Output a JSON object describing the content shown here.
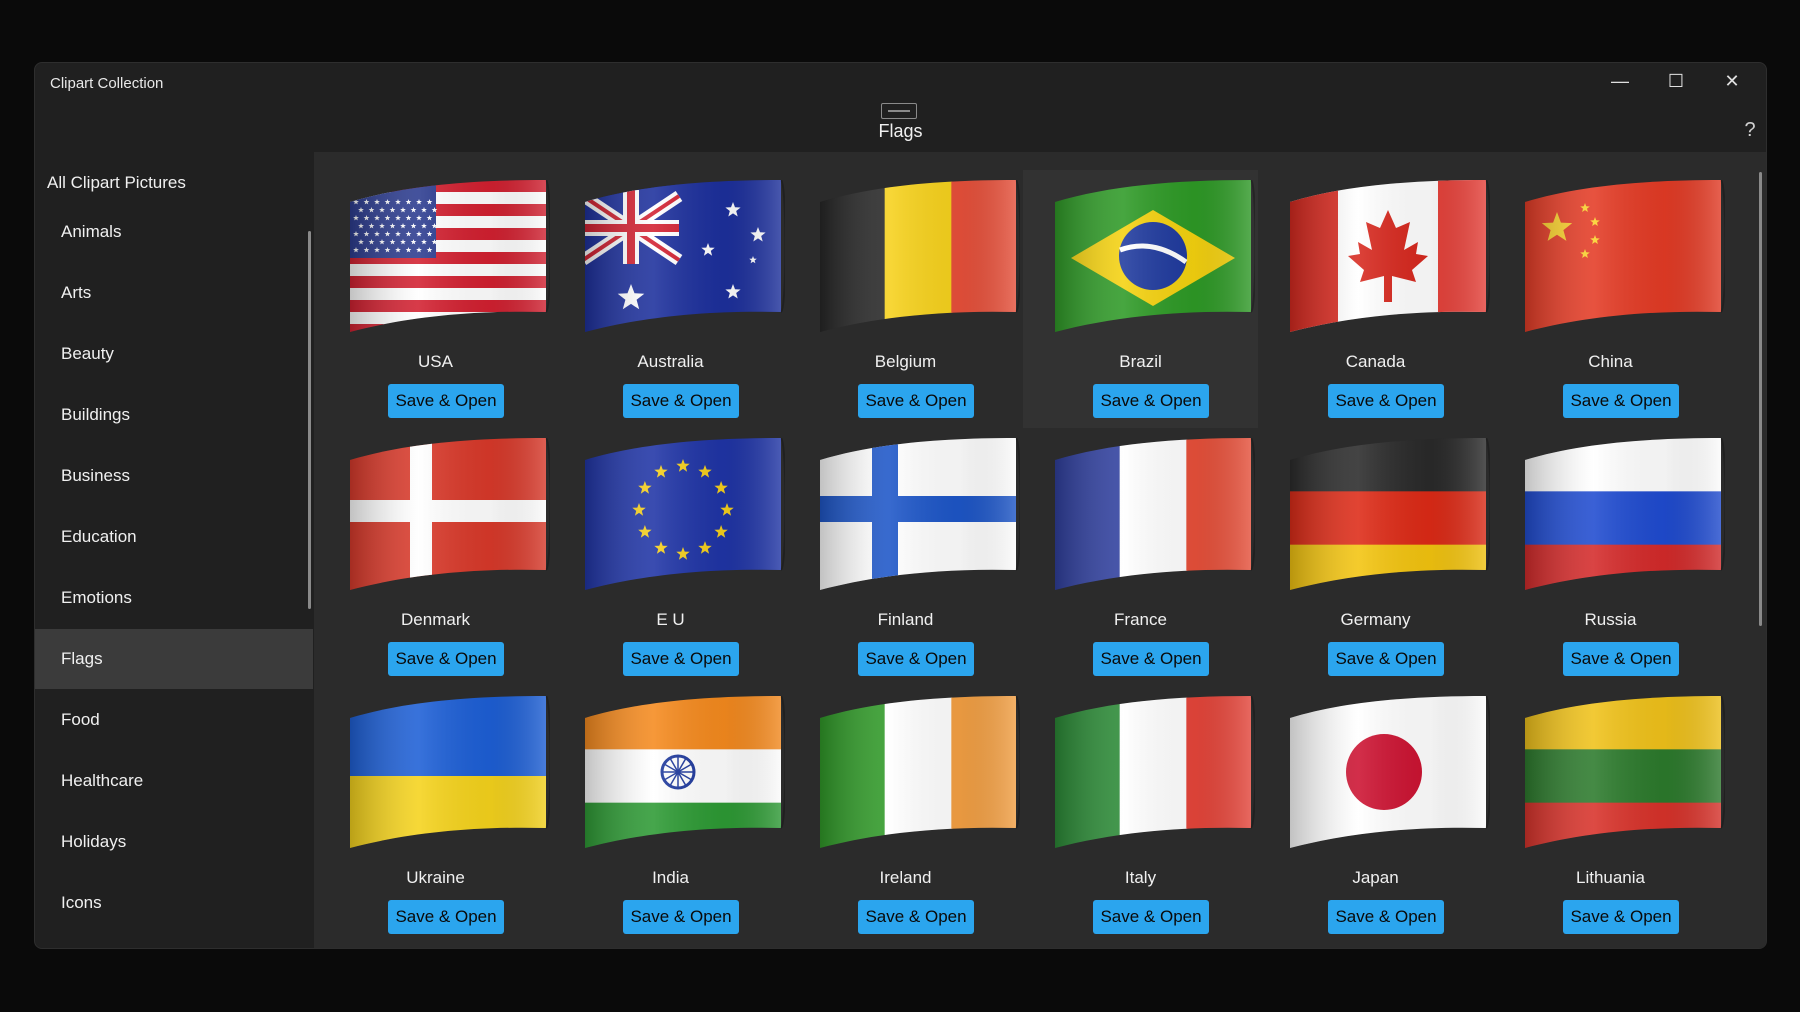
{
  "window": {
    "title": "Clipart Collection",
    "controls": {
      "minimize": "—",
      "maximize": "☐",
      "close": "✕"
    }
  },
  "header": {
    "title": "Flags",
    "help": "?"
  },
  "sidebar": {
    "all_label": "All Clipart Pictures",
    "items": [
      {
        "label": "Animals"
      },
      {
        "label": "Arts"
      },
      {
        "label": "Beauty"
      },
      {
        "label": "Buildings"
      },
      {
        "label": "Business"
      },
      {
        "label": "Education"
      },
      {
        "label": "Emotions"
      },
      {
        "label": "Flags",
        "active": true
      },
      {
        "label": "Food"
      },
      {
        "label": "Healthcare"
      },
      {
        "label": "Holidays"
      },
      {
        "label": "Icons"
      }
    ]
  },
  "button_label": "Save & Open",
  "flags": [
    {
      "name": "USA",
      "icon": "usa-flag-icon"
    },
    {
      "name": "Australia",
      "icon": "australia-flag-icon"
    },
    {
      "name": "Belgium",
      "icon": "belgium-flag-icon"
    },
    {
      "name": "Brazil",
      "icon": "brazil-flag-icon"
    },
    {
      "name": "Canada",
      "icon": "canada-flag-icon"
    },
    {
      "name": "China",
      "icon": "china-flag-icon"
    },
    {
      "name": "Denmark",
      "icon": "denmark-flag-icon"
    },
    {
      "name": "E U",
      "icon": "eu-flag-icon"
    },
    {
      "name": "Finland",
      "icon": "finland-flag-icon"
    },
    {
      "name": "France",
      "icon": "france-flag-icon"
    },
    {
      "name": "Germany",
      "icon": "germany-flag-icon"
    },
    {
      "name": "Russia",
      "icon": "russia-flag-icon"
    },
    {
      "name": "Ukraine",
      "icon": "ukraine-flag-icon"
    },
    {
      "name": "India",
      "icon": "india-flag-icon"
    },
    {
      "name": "Ireland",
      "icon": "ireland-flag-icon"
    },
    {
      "name": "Italy",
      "icon": "italy-flag-icon"
    },
    {
      "name": "Japan",
      "icon": "japan-flag-icon"
    },
    {
      "name": "Lithuania",
      "icon": "lithuania-flag-icon"
    }
  ]
}
